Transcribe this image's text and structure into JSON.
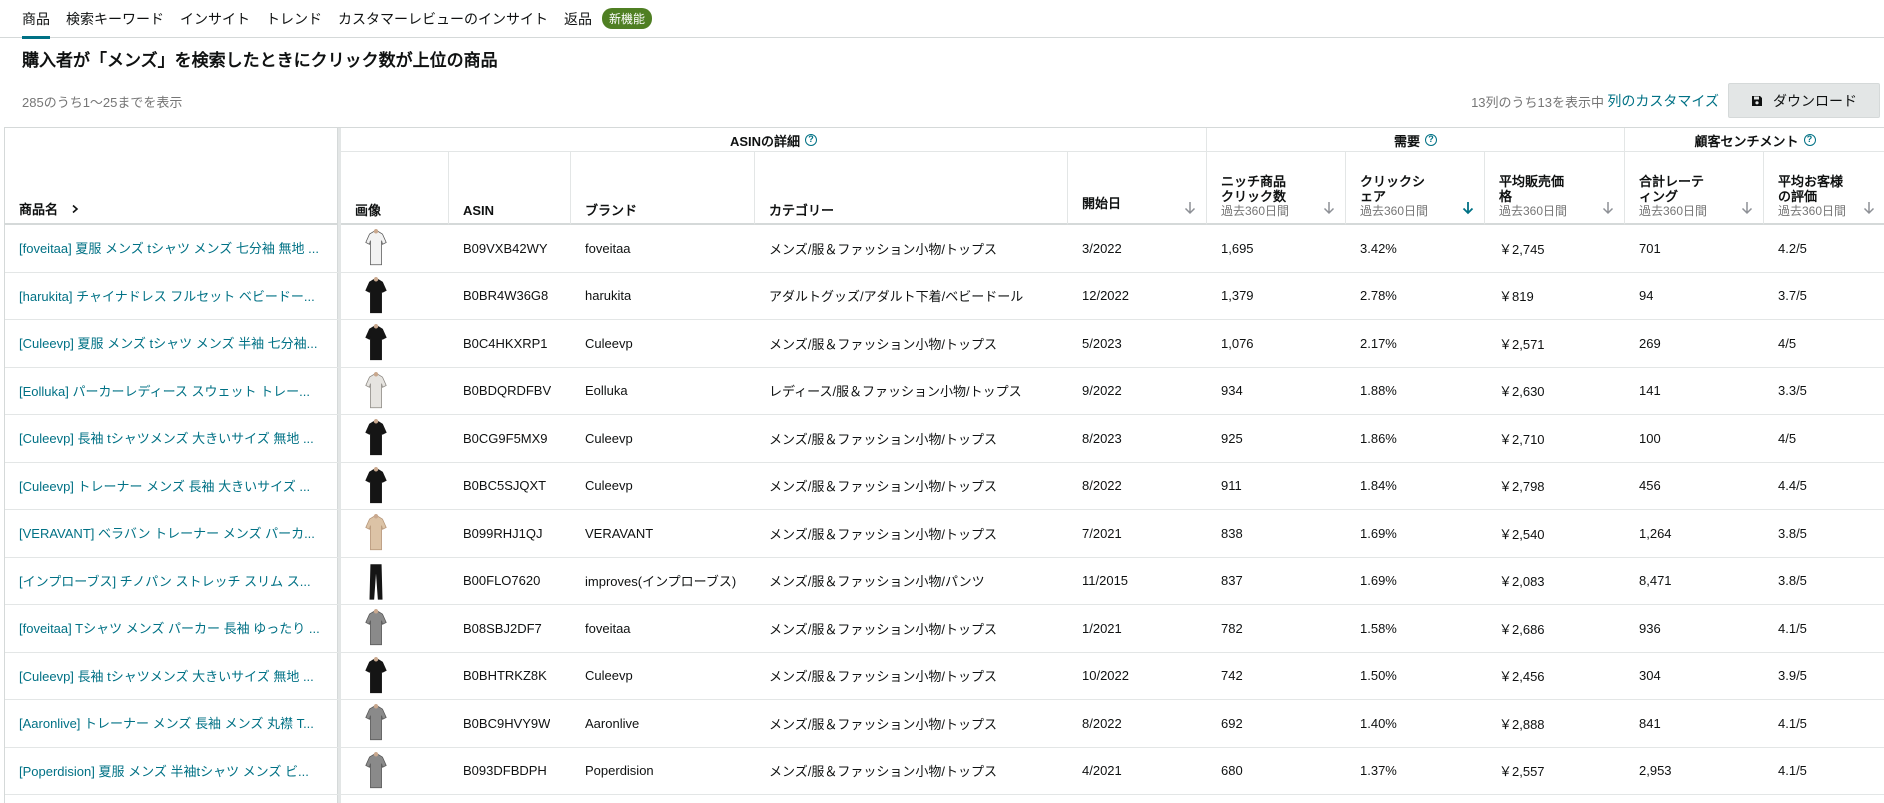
{
  "tabs": [
    {
      "label": "商品",
      "active": true
    },
    {
      "label": "検索キーワード"
    },
    {
      "label": "インサイト"
    },
    {
      "label": "トレンド"
    },
    {
      "label": "カスタマーレビューのインサイト"
    },
    {
      "label": "返品"
    }
  ],
  "new_badge": "新機能",
  "title": "購入者が「メンズ」を検索したときにクリック数が上位の商品",
  "result_count": "285のうち1〜25までを表示",
  "column_count": "13列のうち13を表示中",
  "customize_label": "列のカスタマイズ",
  "download_label": "ダウンロード",
  "groups": {
    "asin_details": "ASINの詳細",
    "demand": "需要",
    "sentiment": "顧客センチメント"
  },
  "columns": {
    "name": "商品名",
    "image": "画像",
    "asin": "ASIN",
    "brand": "ブランド",
    "category": "カテゴリー",
    "launch": "開始日",
    "clicks": "ニッチ商品クリック数",
    "clicks_a": "ニッチ商品",
    "clicks_b": "クリック数",
    "click_share_a": "クリックシ",
    "click_share_b": "ェア",
    "avg_price_a": "平均販売価",
    "avg_price_b": "格",
    "ratings_a": "合計レーテ",
    "ratings_b": "ィング",
    "avg_rating_a": "平均お客様",
    "avg_rating_b": "の評価",
    "period": "過去360日間"
  },
  "rows": [
    {
      "name": "[foveitaa] 夏服 メンズ tシャツ メンズ 七分袖 無地 ...",
      "asin": "B09VXB42WY",
      "brand": "foveitaa",
      "category": "メンズ/服＆ファッション小物/トップス",
      "launch": "3/2022",
      "clicks": "1,695",
      "share": "3.42%",
      "price": "￥2,745",
      "ratings": "701",
      "rating": "4.2/5",
      "img": "white"
    },
    {
      "name": "[harukita] チャイナドレス フルセット ベビードー...",
      "asin": "B0BR4W36G8",
      "brand": "harukita",
      "category": "アダルトグッズ/アダルト下着/ベビードール",
      "launch": "12/2022",
      "clicks": "1,379",
      "share": "2.78%",
      "price": "￥819",
      "ratings": "94",
      "rating": "3.7/5",
      "img": "black"
    },
    {
      "name": "[Culeevp] 夏服 メンズ tシャツ メンズ 半袖 七分袖...",
      "asin": "B0C4HKXRP1",
      "brand": "Culeevp",
      "category": "メンズ/服＆ファッション小物/トップス",
      "launch": "5/2023",
      "clicks": "1,076",
      "share": "2.17%",
      "price": "￥2,571",
      "ratings": "269",
      "rating": "4/5",
      "img": "black"
    },
    {
      "name": "[Eolluka] パーカーレディース スウェット トレー...",
      "asin": "B0BDQRDFBV",
      "brand": "Eolluka",
      "category": "レディース/服＆ファッション小物/トップス",
      "launch": "9/2022",
      "clicks": "934",
      "share": "1.88%",
      "price": "￥2,630",
      "ratings": "141",
      "rating": "3.3/5",
      "img": "light"
    },
    {
      "name": "[Culeevp] 長袖 tシャツメンズ 大きいサイズ 無地 ...",
      "asin": "B0CG9F5MX9",
      "brand": "Culeevp",
      "category": "メンズ/服＆ファッション小物/トップス",
      "launch": "8/2023",
      "clicks": "925",
      "share": "1.86%",
      "price": "￥2,710",
      "ratings": "100",
      "rating": "4/5",
      "img": "black"
    },
    {
      "name": "[Culeevp] トレーナー メンズ 長袖 大きいサイズ ...",
      "asin": "B0BC5SJQXT",
      "brand": "Culeevp",
      "category": "メンズ/服＆ファッション小物/トップス",
      "launch": "8/2022",
      "clicks": "911",
      "share": "1.84%",
      "price": "￥2,798",
      "ratings": "456",
      "rating": "4.4/5",
      "img": "black"
    },
    {
      "name": "[VERAVANT] ベラバン トレーナー メンズ パーカ...",
      "asin": "B099RHJ1QJ",
      "brand": "VERAVANT",
      "category": "メンズ/服＆ファッション小物/トップス",
      "launch": "7/2021",
      "clicks": "838",
      "share": "1.69%",
      "price": "￥2,540",
      "ratings": "1,264",
      "rating": "3.8/5",
      "img": "tan"
    },
    {
      "name": "[インプローブス] チノパン ストレッチ スリム ス...",
      "asin": "B00FLO7620",
      "brand": "improves(インプローブス)",
      "category": "メンズ/服＆ファッション小物/パンツ",
      "launch": "11/2015",
      "clicks": "837",
      "share": "1.69%",
      "price": "￥2,083",
      "ratings": "8,471",
      "rating": "3.8/5",
      "img": "pants"
    },
    {
      "name": "[foveitaa] Tシャツ メンズ パーカー 長袖 ゆったり ...",
      "asin": "B08SBJ2DF7",
      "brand": "foveitaa",
      "category": "メンズ/服＆ファッション小物/トップス",
      "launch": "1/2021",
      "clicks": "782",
      "share": "1.58%",
      "price": "￥2,686",
      "ratings": "936",
      "rating": "4.1/5",
      "img": "gray"
    },
    {
      "name": "[Culeevp] 長袖 tシャツメンズ 大きいサイズ 無地 ...",
      "asin": "B0BHTRKZ8K",
      "brand": "Culeevp",
      "category": "メンズ/服＆ファッション小物/トップス",
      "launch": "10/2022",
      "clicks": "742",
      "share": "1.50%",
      "price": "￥2,456",
      "ratings": "304",
      "rating": "3.9/5",
      "img": "black"
    },
    {
      "name": "[Aaronlive] トレーナー メンズ 長袖 メンズ 丸襟 T...",
      "asin": "B0BC9HVY9W",
      "brand": "Aaronlive",
      "category": "メンズ/服＆ファッション小物/トップス",
      "launch": "8/2022",
      "clicks": "692",
      "share": "1.40%",
      "price": "￥2,888",
      "ratings": "841",
      "rating": "4.1/5",
      "img": "gray"
    },
    {
      "name": "[Poperdision] 夏服 メンズ 半袖tシャツ メンズ ビ...",
      "asin": "B093DFBDPH",
      "brand": "Poperdision",
      "category": "メンズ/服＆ファッション小物/トップス",
      "launch": "4/2021",
      "clicks": "680",
      "share": "1.37%",
      "price": "￥2,557",
      "ratings": "2,953",
      "rating": "4.1/5",
      "img": "gray"
    }
  ],
  "colors": {
    "link": "#007185",
    "badge": "#4f7f23",
    "border": "#d5d9d9"
  }
}
